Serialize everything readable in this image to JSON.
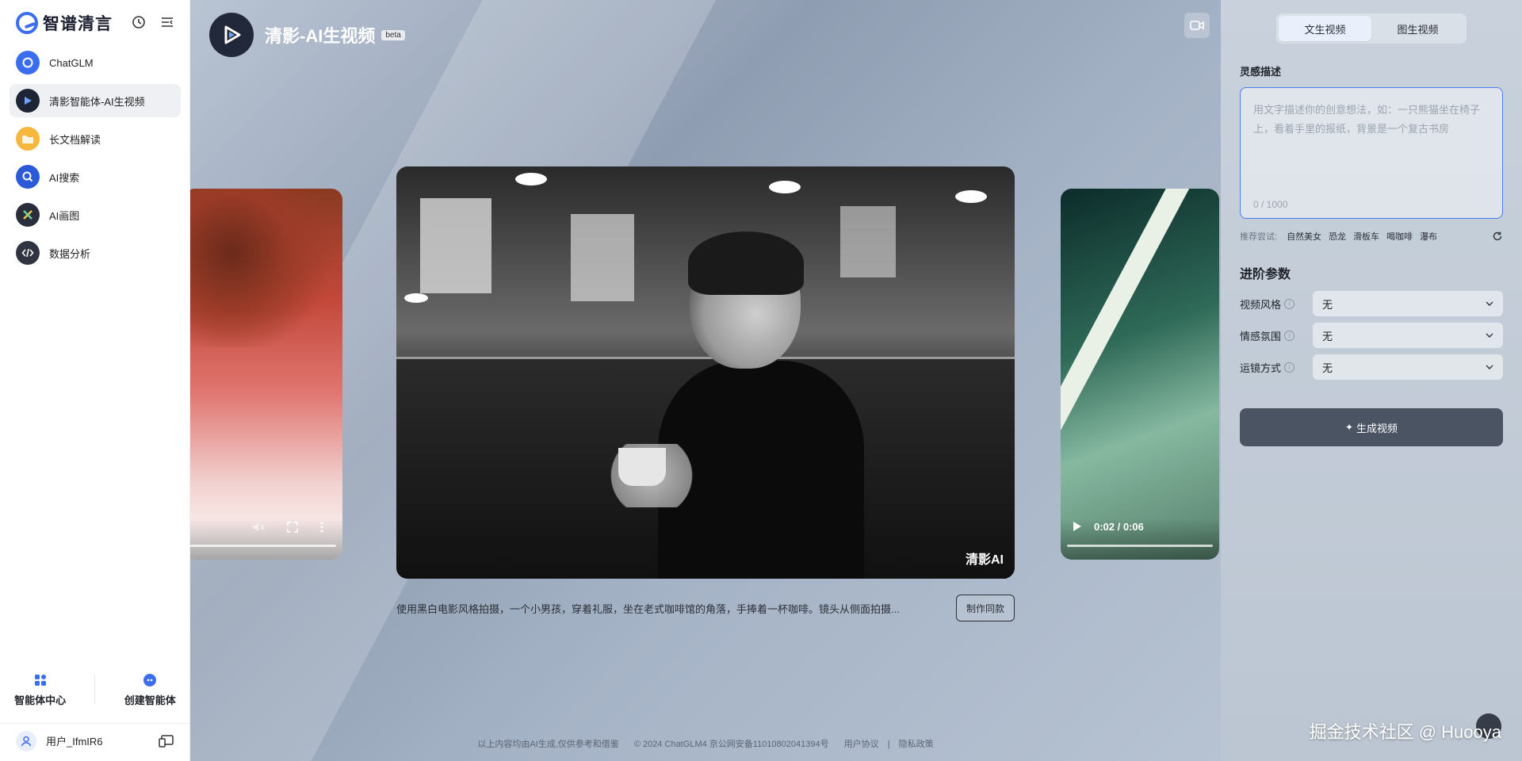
{
  "sidebar": {
    "brand": "智谱清言",
    "items": [
      {
        "label": "ChatGLM",
        "icon": "chatglm-icon"
      },
      {
        "label": "清影智能体-AI生视频",
        "icon": "qingying-icon",
        "active": true
      },
      {
        "label": "长文档解读",
        "icon": "folder-icon"
      },
      {
        "label": "AI搜索",
        "icon": "search-icon"
      },
      {
        "label": "AI画图",
        "icon": "draw-icon"
      },
      {
        "label": "数据分析",
        "icon": "code-icon"
      }
    ],
    "bottom": {
      "agent_center": "智能体中心",
      "create_agent": "创建智能体"
    },
    "user": "用户_IfmIR6"
  },
  "header": {
    "title": "清影-AI生视频",
    "badge": "beta"
  },
  "videos": {
    "right_time": "0:02 / 0:06",
    "main_watermark": "清影AI"
  },
  "caption": {
    "text": "使用黑白电影风格拍摄，一个小男孩，穿着礼服，坐在老式咖啡馆的角落，手捧着一杯咖啡。镜头从侧面拍摄...",
    "button": "制作同款"
  },
  "footer": {
    "notice": "以上内容均由AI生成,仅供参考和借鉴",
    "copyright": "© 2024 ChatGLM4 京公网安备11010802041394号",
    "agreement": "用户协议",
    "privacy": "隐私政策"
  },
  "panel": {
    "tabs": [
      "文生视频",
      "图生视频"
    ],
    "active_tab": 0,
    "prompt_label": "灵感描述",
    "prompt_placeholder": "用文字描述你的创意想法，如：一只熊猫坐在椅子上，看着手里的报纸，背景是一个复古书房",
    "prompt_counter": "0 / 1000",
    "suggest_label": "推荐尝试:",
    "suggestions": [
      "自然美女",
      "恐龙",
      "滑板车",
      "喝咖啡",
      "瀑布"
    ],
    "advanced_title": "进阶参数",
    "params": [
      {
        "label": "视频风格",
        "value": "无"
      },
      {
        "label": "情感氛围",
        "value": "无"
      },
      {
        "label": "运镜方式",
        "value": "无"
      }
    ],
    "generate_button": "生成视频"
  },
  "watermark": "掘金技术社区 @ Huooya",
  "colors": {
    "accent": "#3b6df0",
    "primary_button": "#4a5462"
  }
}
